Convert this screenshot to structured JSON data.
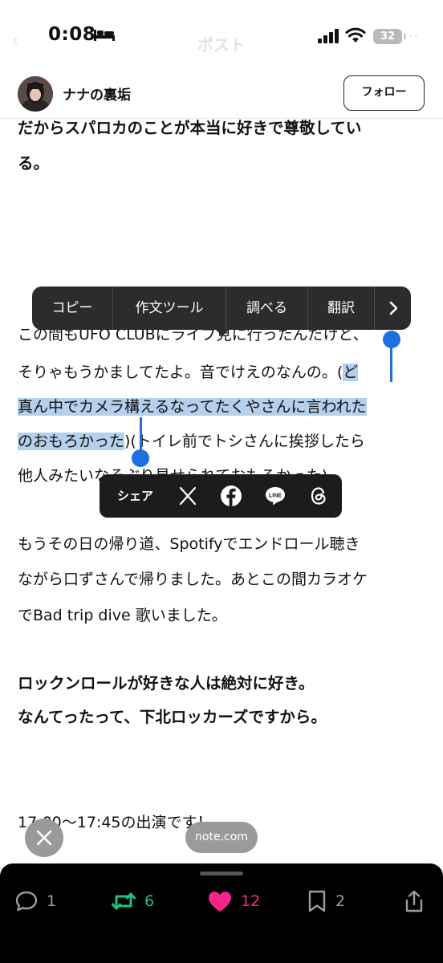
{
  "status_bar": {
    "time": "0:08",
    "battery": "32"
  },
  "nav": {
    "title": "ポスト"
  },
  "author": {
    "name": "ナナの裏垢",
    "follow_label": "フォロー"
  },
  "article": {
    "bold_intro": [
      "だからスパロカのことが本当に好きで尊敬してい",
      "る。"
    ],
    "p1": {
      "line1": "この間もUFO CLUBにライブ見に行ったんだけど、",
      "line2_plain": "そりゃもうかましてたよ。音でけえのなんの。(",
      "line2_sel": "ど",
      "line3_sel": "真ん中でカメラ構えるなってたくやさんに言われた",
      "line4_sel": "のおもろかった",
      "line4_plain": ")(トイレ前でトシさんに挨拶したら",
      "line5": "他人みたいなそぶり見せられておもろかった)"
    },
    "p2": [
      "もうその日の帰り道、Spotifyでエンドロール聴き",
      "ながら口ずさんで帰りました。あとこの間カラオケ",
      "でBad trip dive 歌いました。"
    ],
    "bold_outro": [
      "ロックンロールが好きな人は絶対に好き。",
      "なんてったって、下北ロッカーズですから。"
    ],
    "footer_line": "17:00〜17:45の出演です！"
  },
  "context_menu": {
    "items": [
      "コピー",
      "作文ツール",
      "調べる",
      "翻訳"
    ],
    "more_icon": "chevron-right-icon"
  },
  "share_bar": {
    "label": "シェア",
    "icons": [
      "x-icon",
      "facebook-icon",
      "line-icon",
      "threads-icon"
    ]
  },
  "floating": {
    "note_label": "note.com"
  },
  "actions": {
    "comments": "1",
    "reposts": "6",
    "likes": "12",
    "bookmarks": "2",
    "colors": {
      "repost": "#1dc27f",
      "like": "#f7258a",
      "neutral": "#9c9c9c",
      "selection": "#b4d0ec",
      "handle": "#1f6fe0"
    }
  }
}
